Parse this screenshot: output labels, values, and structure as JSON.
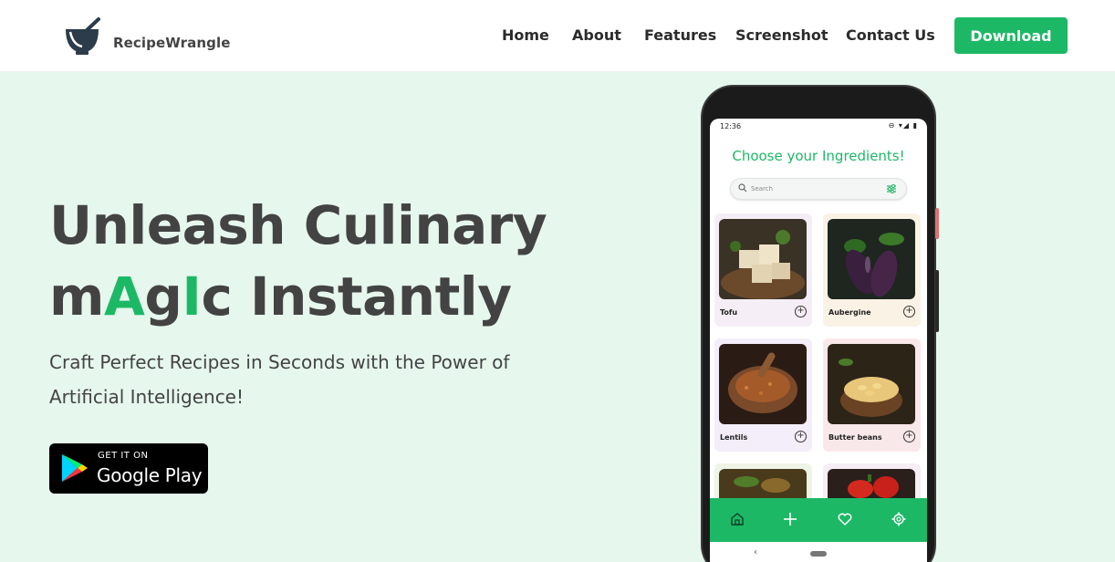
{
  "navbar": {
    "brand": "RecipeWrangle",
    "links": [
      "Home",
      "About",
      "Features",
      "Screenshot",
      "Contact Us"
    ],
    "download_label": "Download"
  },
  "hero": {
    "title_line1": "Unleash Culinary",
    "title_line2_parts": [
      "m",
      "A",
      "g",
      "I",
      "c",
      " Instantly"
    ],
    "subtitle": "Craft Perfect Recipes in Seconds with the Power of Artificial Intelligence!",
    "store_badge": {
      "small": "GET IT ON",
      "big": "Google Play"
    }
  },
  "colors": {
    "accent": "#1db866",
    "hero_bg": "#e6f7ee",
    "text": "#434343"
  },
  "phone": {
    "status_time": "12:36",
    "status_icons": "⊖ ▾◢ ▮",
    "screen_title": "Choose your Ingredients!",
    "search_placeholder": "Search",
    "ingredients": [
      "Tofu",
      "Aubergine",
      "Lentils",
      "Butter beans"
    ],
    "tab_icons": [
      "home-icon",
      "plus-icon",
      "heart-icon",
      "gear-icon"
    ],
    "back_glyph": "‹"
  }
}
